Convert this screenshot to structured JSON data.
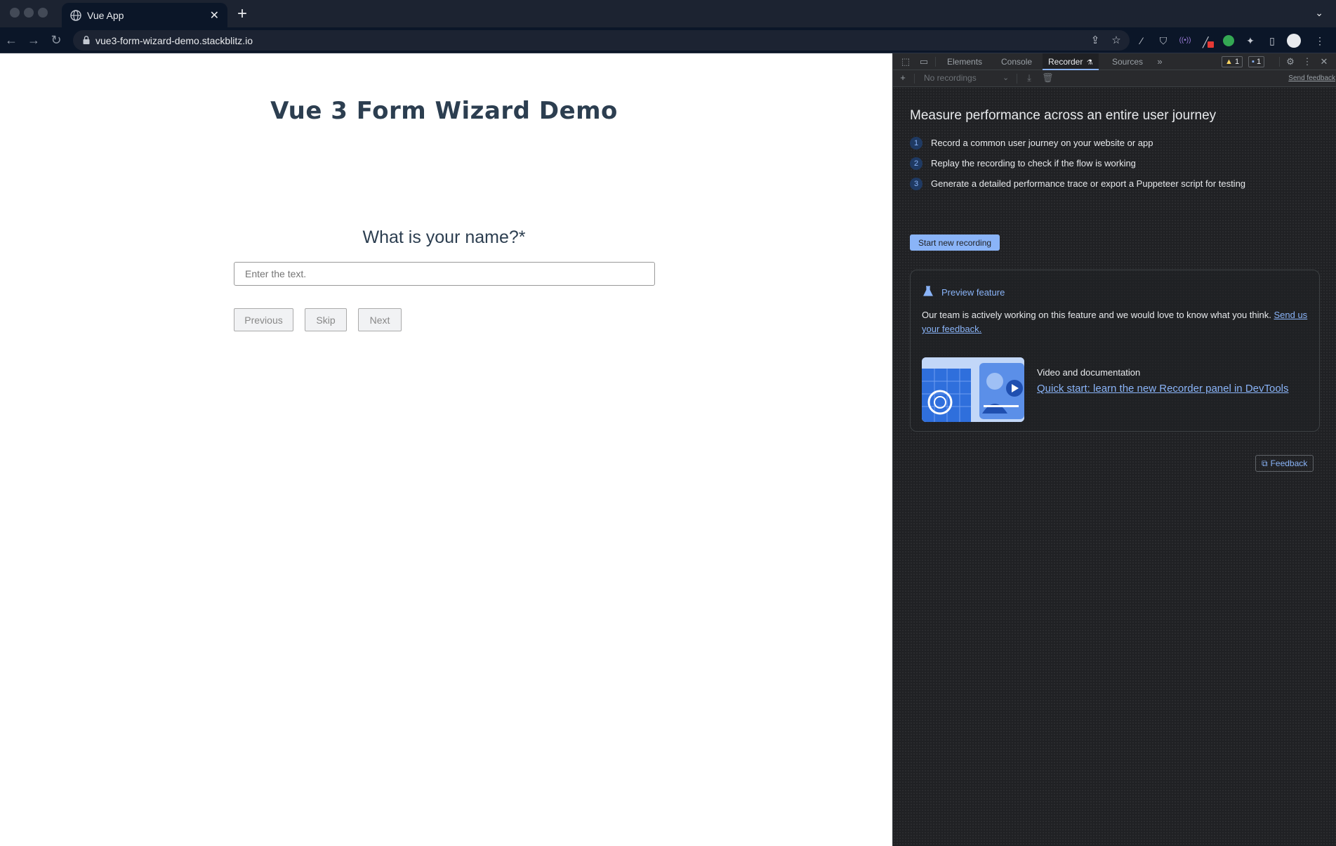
{
  "browser": {
    "tab_title": "Vue App",
    "url": "vue3-form-wizard-demo.stackblitz.io"
  },
  "page": {
    "title": "Vue 3 Form Wizard Demo",
    "question": "What is your name?*",
    "input_placeholder": "Enter the text.",
    "buttons": {
      "previous": "Previous",
      "skip": "Skip",
      "next": "Next"
    }
  },
  "devtools": {
    "tabs": [
      "Elements",
      "Console",
      "Recorder",
      "Sources"
    ],
    "active_tab": "Recorder",
    "warnings_count": "1",
    "messages_count": "1",
    "recordings_select": "No recordings",
    "send_feedback": "Send feedback",
    "recorder": {
      "heading": "Measure performance across an entire user journey",
      "steps": [
        {
          "num": "1",
          "text": "Record a common user journey on your website or app"
        },
        {
          "num": "2",
          "text": "Replay the recording to check if the flow is working"
        },
        {
          "num": "3",
          "text": "Generate a detailed performance trace or export a Puppeteer script for testing"
        }
      ],
      "start_button": "Start new recording",
      "preview": {
        "title": "Preview feature",
        "description": "Our team is actively working on this feature and we would love to know what you think.",
        "description_link": "Send us your feedback.",
        "video_label": "Video and documentation",
        "video_link": "Quick start: learn the new Recorder panel in DevTools"
      },
      "feedback_button": "Feedback"
    }
  },
  "colors": {
    "accent": "#8ab4f8",
    "page_text": "#2c3e50",
    "devtools_bg": "#202124"
  }
}
